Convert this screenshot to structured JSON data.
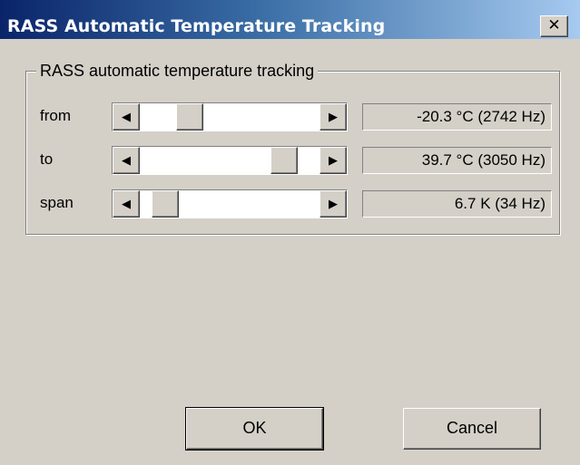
{
  "window": {
    "title": "RASS Automatic Temperature Tracking",
    "close_glyph": "✕"
  },
  "group": {
    "legend": "RASS automatic temperature tracking",
    "rows": [
      {
        "label": "from",
        "value_text": "-20.3 °C (2742 Hz)",
        "position_fraction": 0.24
      },
      {
        "label": "to",
        "value_text": "39.7 °C (3050 Hz)",
        "position_fraction": 0.86
      },
      {
        "label": "span",
        "value_text": "6.7 K (34 Hz)",
        "position_fraction": 0.08
      }
    ],
    "scroll_left_glyph": "◀",
    "scroll_right_glyph": "▶"
  },
  "buttons": {
    "ok": "OK",
    "cancel": "Cancel"
  }
}
